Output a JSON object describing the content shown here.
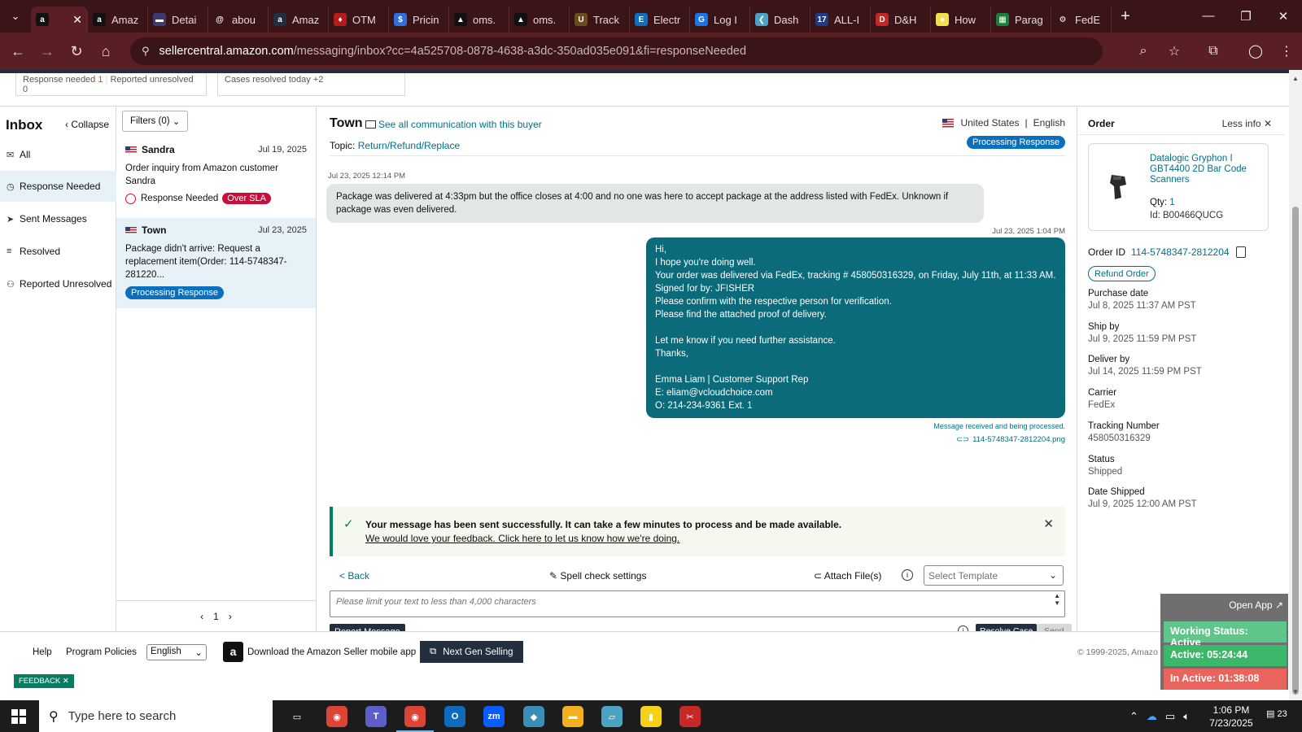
{
  "browser": {
    "tabs": [
      {
        "label": "",
        "favicon": "amazon-icon",
        "color": "#111111",
        "glyph": "a",
        "active": true
      },
      {
        "label": "Amaz",
        "favicon": "amazon-icon",
        "color": "#111111",
        "glyph": "a"
      },
      {
        "label": "Detai",
        "favicon": "flag-icon",
        "color": "#3c3b6e",
        "glyph": "▬"
      },
      {
        "label": "abou",
        "favicon": "chat-icon",
        "color": "#3b1418",
        "glyph": "@"
      },
      {
        "label": "Amaz",
        "favicon": "amazon-icon",
        "color": "#232f3e",
        "glyph": "a"
      },
      {
        "label": "OTM",
        "favicon": "otm-icon",
        "color": "#b71c1c",
        "glyph": "♦"
      },
      {
        "label": "Pricin",
        "favicon": "dollar-icon",
        "color": "#2f6fde",
        "glyph": "$"
      },
      {
        "label": "oms.",
        "favicon": "triangle-icon",
        "color": "#111111",
        "glyph": "▲"
      },
      {
        "label": "oms.",
        "favicon": "triangle-icon",
        "color": "#111111",
        "glyph": "▲"
      },
      {
        "label": "Track",
        "favicon": "ups-icon",
        "color": "#6b4b1d",
        "glyph": "U"
      },
      {
        "label": "Electr",
        "favicon": "eg-icon",
        "color": "#0a6fbc",
        "glyph": "E"
      },
      {
        "label": "Log I",
        "favicon": "g-icon",
        "color": "#1a73e8",
        "glyph": "G"
      },
      {
        "label": "Dash",
        "favicon": "dash-icon",
        "color": "#4aa3c3",
        "glyph": "❮"
      },
      {
        "label": "ALL-I",
        "favicon": "seventeen-icon",
        "color": "#1e3a8a",
        "glyph": "17"
      },
      {
        "label": "D&H",
        "favicon": "dh-icon",
        "color": "#c62828",
        "glyph": "D"
      },
      {
        "label": "How",
        "favicon": "circle-icon",
        "color": "#f4e04d",
        "glyph": "●"
      },
      {
        "label": "Parag",
        "favicon": "sheets-icon",
        "color": "#188038",
        "glyph": "▦"
      },
      {
        "label": "FedE",
        "favicon": "gear-icon",
        "color": "#3b1418",
        "glyph": "⚙"
      }
    ],
    "url_domain": "sellercentral.amazon.com",
    "url_path": "/messaging/inbox?cc=4a525708-0878-4638-a3dc-350ad035e091&fi=responseNeeded"
  },
  "stats": {
    "response_needed_label": "Response needed",
    "response_needed_count": "1",
    "reported_unresolved_label": "Reported unresolved",
    "reported_unresolved_count": "0",
    "cases_resolved_label": "Cases resolved today",
    "cases_resolved_count": "+2"
  },
  "leftnav": {
    "title": "Inbox",
    "collapse": "Collapse",
    "items": [
      {
        "label": "All",
        "icon": "mail-icon"
      },
      {
        "label": "Response Needed",
        "icon": "clock-icon"
      },
      {
        "label": "Sent Messages",
        "icon": "send-icon"
      },
      {
        "label": "Resolved",
        "icon": "list-icon"
      },
      {
        "label": "Reported Unresolved",
        "icon": "person-icon"
      }
    ]
  },
  "convlist": {
    "filters": "Filters (0)",
    "conversations": [
      {
        "name": "Sandra",
        "date": "Jul 19, 2025",
        "text": "Order inquiry from Amazon customer Sandra",
        "status": "Response Needed",
        "badge": "Over SLA"
      },
      {
        "name": "Town",
        "date": "Jul 23, 2025",
        "text": "Package didn't arrive: Request a replacement item(Order: 114-5748347-281220...",
        "badge": "Processing Response"
      }
    ],
    "page": "1"
  },
  "thread": {
    "buyer": "Town",
    "see_all": "See all communication with this buyer",
    "topic_label": "Topic:",
    "topic_value": "Return/Refund/Replace",
    "country": "United States",
    "language": "English",
    "status_badge": "Processing Response",
    "incoming_time": "Jul 23, 2025 12:14 PM",
    "incoming_text": "Package was delivered at 4:33pm but the office closes at 4:00 and no one was here to accept package at the address listed with FedEx. Unknown if package was even delivered.",
    "outgoing_time": "Jul 23, 2025 1:04 PM",
    "outgoing_lines": [
      "Hi,",
      "I hope you're doing well.",
      "Your order was delivered via FedEx, tracking # 458050316329, on Friday, July 11th, at 11:33 AM.",
      "Signed for by: JFISHER",
      "Please confirm with the respective person for verification.",
      "Please find the attached proof of delivery.",
      "",
      "Let me know if you need further assistance.",
      "Thanks,",
      "",
      "Emma Liam | Customer Support Rep",
      "E: eliam@vcloudchoice.com",
      "O: 214-234-9361 Ext. 1"
    ],
    "outgoing_status": "Message received and being processed.",
    "attachment": "114-5748347-2812204.png"
  },
  "success": {
    "message": "Your message has been sent successfully. It can take a few minutes to process and be made available.",
    "feedback_link": "We would love your feedback. Click here to let us know how we're doing."
  },
  "composer": {
    "back": "< Back",
    "spell": "Spell check settings",
    "attach": "Attach File(s)",
    "template_placeholder": "Select Template",
    "text_placeholder": "Please limit your text to less than 4,000 characters",
    "report": "Report Message",
    "resolve": "Resolve Case",
    "send": "Send"
  },
  "order": {
    "title": "Order",
    "less_info": "Less info",
    "product_name": "Datalogic Gryphon I GBT4400 2D Bar Code Scanners",
    "qty_label": "Qty:",
    "qty_value": "1",
    "id_label": "Id:",
    "id_value": "B00466QUCG",
    "order_id_label": "Order ID",
    "order_id_value": "114-5748347-2812204",
    "refund": "Refund Order",
    "fields": [
      {
        "k": "Purchase date",
        "v": "Jul 8, 2025 11:37 AM PST"
      },
      {
        "k": "Ship by",
        "v": "Jul 9, 2025 11:59 PM PST"
      },
      {
        "k": "Deliver by",
        "v": "Jul 14, 2025 11:59 PM PST"
      },
      {
        "k": "Carrier",
        "v": "FedEx"
      },
      {
        "k": "Tracking Number",
        "v": "458050316329"
      },
      {
        "k": "Status",
        "v": "Shipped"
      },
      {
        "k": "Date Shipped",
        "v": "Jul 9, 2025 12:00 AM PST"
      }
    ]
  },
  "footer": {
    "help": "Help",
    "policies": "Program Policies",
    "language": "English",
    "app": "Download the Amazon Seller mobile app",
    "ngs": "Next Gen Selling",
    "copyright": "© 1999-2025, Amazo",
    "feedback": "FEEDBACK"
  },
  "widget": {
    "open_app": "Open App",
    "status": "Working Status: Active",
    "active": "Active: 05:24:44",
    "inactive": "In Active: 01:38:08",
    "status_color": "#5fc58a",
    "active_color": "#3cb86a",
    "inactive_color": "#e8645c"
  },
  "taskbar": {
    "search_placeholder": "Type here to search",
    "time": "1:06 PM",
    "date": "7/23/2025",
    "notifications": "23",
    "apps": [
      {
        "name": "task-view-icon",
        "color": "#1c1c1c",
        "glyph": "▭"
      },
      {
        "name": "chrome-icon",
        "color": "#db4437",
        "glyph": "◉"
      },
      {
        "name": "teams-icon",
        "color": "#5b5fc7",
        "glyph": "T"
      },
      {
        "name": "chrome-profile-icon",
        "color": "#db4437",
        "glyph": "◉"
      },
      {
        "name": "outlook-icon",
        "color": "#0f6cbd",
        "glyph": "O"
      },
      {
        "name": "zoom-icon",
        "color": "#0b5cff",
        "glyph": "zm"
      },
      {
        "name": "app-diamond-icon",
        "color": "#3a8fb7",
        "glyph": "◆"
      },
      {
        "name": "file-explorer-icon",
        "color": "#f2b01e",
        "glyph": "▬"
      },
      {
        "name": "notes-icon",
        "color": "#4aa3c3",
        "glyph": "▱"
      },
      {
        "name": "sticky-notes-icon",
        "color": "#f7d117",
        "glyph": "▮"
      },
      {
        "name": "snip-icon",
        "color": "#c62828",
        "glyph": "✂"
      }
    ]
  }
}
